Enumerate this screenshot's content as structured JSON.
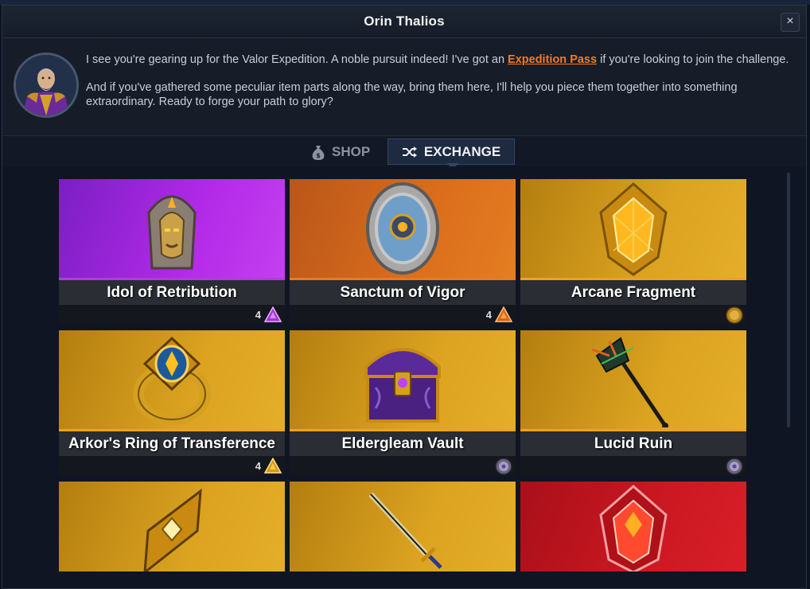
{
  "window": {
    "title": "Orin Thalios"
  },
  "dialog": {
    "line1_before": "I see you're gearing up for the Valor Expedition. A noble pursuit indeed! I've got an ",
    "line1_link": "Expedition Pass",
    "line1_after": " if you're looking to join the challenge.",
    "line2": "And if you've gathered some peculiar item parts along the way, bring them here, I'll help you piece them together into something extraordinary. Ready to forge your path to glory?"
  },
  "tabs": {
    "shop": "SHOP",
    "exchange": "EXCHANGE",
    "active": "EXCHANGE"
  },
  "items": [
    {
      "name": "Idol of Retribution",
      "rarity_color": "#b33be0",
      "cost": "4",
      "cost_icon": "purple-shard-icon"
    },
    {
      "name": "Sanctum of Vigor",
      "rarity_color": "#e87a20",
      "cost": "4",
      "cost_icon": "orange-shard-icon"
    },
    {
      "name": "Arcane Fragment",
      "rarity_color": "#f0a021",
      "cost": "",
      "cost_icon": "gold-coin-icon"
    },
    {
      "name": "Arkor's Ring of Transference",
      "rarity_color": "#f0a021",
      "cost": "4",
      "cost_icon": "gold-shard-icon"
    },
    {
      "name": "Eldergleam Vault",
      "rarity_color": "#f0a021",
      "cost": "",
      "cost_icon": "silver-emblem-icon"
    },
    {
      "name": "Lucid Ruin",
      "rarity_color": "#f0a021",
      "cost": "",
      "cost_icon": "silver-emblem-icon"
    },
    {
      "name": "",
      "rarity_color": "#f0a021",
      "cost": "",
      "cost_icon": ""
    },
    {
      "name": "",
      "rarity_color": "#f0a021",
      "cost": "",
      "cost_icon": ""
    },
    {
      "name": "",
      "rarity_color": "#d81f28",
      "cost": "",
      "cost_icon": ""
    }
  ]
}
